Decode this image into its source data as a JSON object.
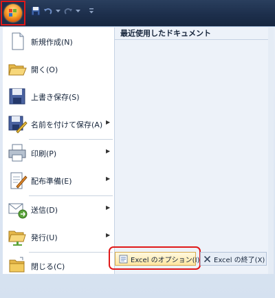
{
  "menu": {
    "items": [
      {
        "label": "新規作成(N)",
        "icon": "new-document-icon",
        "submenu": false
      },
      {
        "label": "開く(O)",
        "icon": "open-folder-icon",
        "submenu": false
      },
      {
        "label": "上書き保存(S)",
        "icon": "save-disk-icon",
        "submenu": false
      },
      {
        "label": "名前を付けて保存(A)",
        "icon": "save-as-icon",
        "submenu": true
      },
      {
        "label": "印刷(P)",
        "icon": "printer-icon",
        "submenu": true
      },
      {
        "label": "配布準備(E)",
        "icon": "prepare-icon",
        "submenu": true
      },
      {
        "label": "送信(D)",
        "icon": "send-icon",
        "submenu": true
      },
      {
        "label": "発行(U)",
        "icon": "publish-icon",
        "submenu": true
      },
      {
        "label": "閉じる(C)",
        "icon": "close-folder-icon",
        "submenu": false
      }
    ],
    "recent_header": "最近使用したドキュメント",
    "options_button": "Excel のオプション(I)",
    "exit_button": "Excel の終了(X)"
  },
  "colors": {
    "highlight_border": "#e01818",
    "title_bar": "#1d2f4c"
  }
}
